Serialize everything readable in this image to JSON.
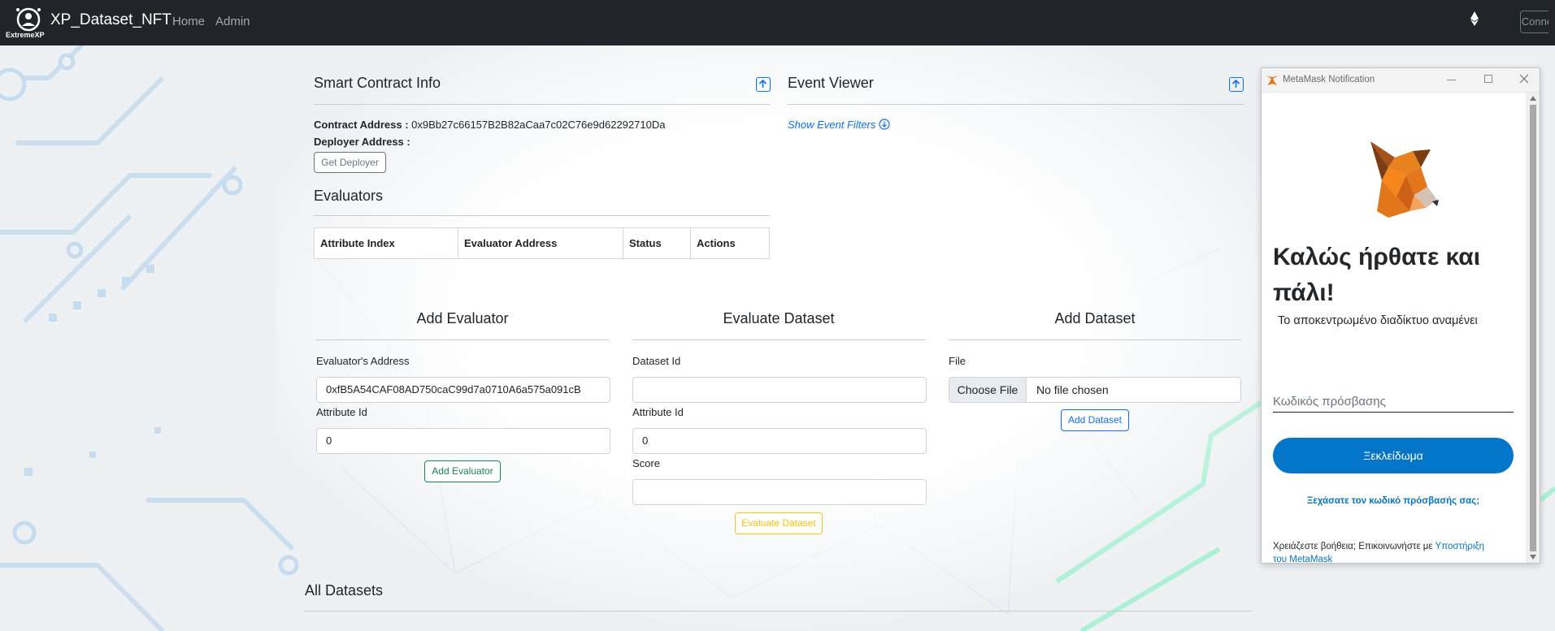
{
  "navbar": {
    "logo_text": "ExtremeXP",
    "brand": "XP_Dataset_NFT",
    "links": [
      "Home",
      "Admin"
    ],
    "eth_icon": "ethereum-icon",
    "connect_label": "Connect"
  },
  "contract_info": {
    "title": "Smart Contract Info",
    "contract_address_label": "Contract Address :",
    "contract_address_value": "0x9Bb27c66157B2B82aCaa7c02C76e9d62292710Da",
    "deployer_address_label": "Deployer Address :",
    "get_deployer_label": "Get Deployer"
  },
  "evaluators": {
    "title": "Evaluators",
    "columns": [
      "Attribute Index",
      "Evaluator Address",
      "Status",
      "Actions"
    ]
  },
  "event_viewer": {
    "title": "Event Viewer",
    "filters_link": "Show Event Filters"
  },
  "add_evaluator": {
    "title": "Add Evaluator",
    "address_label": "Evaluator's Address",
    "address_value": "0xfB5A54CAF08AD750caC99d7a0710A6a575a091cB",
    "attribute_label": "Attribute Id",
    "attribute_value": "0",
    "button_label": "Add Evaluator"
  },
  "evaluate_dataset": {
    "title": "Evaluate Dataset",
    "dataset_label": "Dataset Id",
    "dataset_value": "",
    "attribute_label": "Attribute Id",
    "attribute_value": "0",
    "score_label": "Score",
    "score_value": "",
    "button_label": "Evaluate Dataset"
  },
  "add_dataset": {
    "title": "Add Dataset",
    "file_label": "File",
    "choose_file_label": "Choose File",
    "no_file_label": "No file chosen",
    "button_label": "Add Dataset"
  },
  "all_datasets": {
    "title": "All Datasets"
  },
  "metamask": {
    "window_title": "MetaMask Notification",
    "welcome_line1": "Καλώς ήρθατε και",
    "welcome_line2": "πάλι!",
    "subtitle": "Το αποκεντρωμένο διαδίκτυο αναμένει",
    "password_placeholder": "Κωδικός πρόσβασης",
    "unlock_label": "Ξεκλείδωμα",
    "forgot_label": "Ξεχάσατε τον κωδικό πρόσβασής σας;",
    "help_text": "Χρειάζεστε βοήθεια; Επικοινωνήστε με ",
    "support_link_1": "Υποστήριξη",
    "support_link_2": "του MetaMask"
  },
  "colors": {
    "navbar": "#212529",
    "primary": "#0d6efd",
    "success": "#198754",
    "warning": "#ffc107",
    "metamask_blue": "#0376c9"
  }
}
